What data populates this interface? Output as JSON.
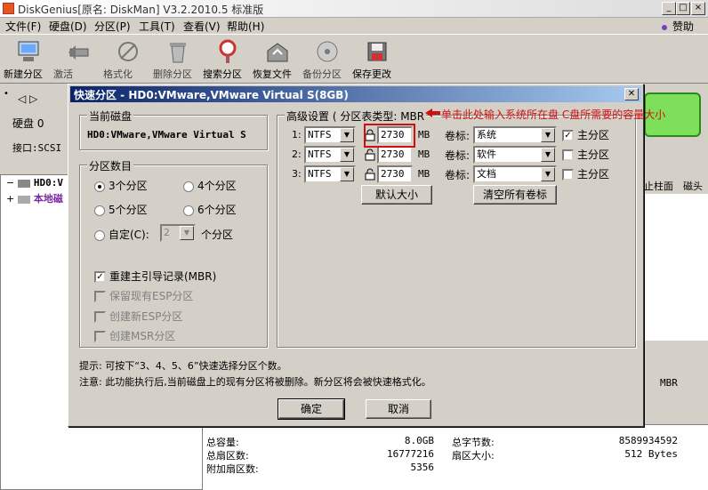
{
  "window": {
    "title": "DiskGenius[原名: DiskMan] V3.2.2010.5 标准版"
  },
  "menu": [
    "文件(F)",
    "硬盘(D)",
    "分区(P)",
    "工具(T)",
    "查看(V)",
    "帮助(H)"
  ],
  "sponsor": "赞助",
  "toolbar": [
    {
      "label": "新建分区",
      "icon": "new-partition-icon"
    },
    {
      "label": "激活",
      "icon": "activate-icon"
    },
    {
      "label": "格式化",
      "icon": "format-icon"
    },
    {
      "label": "删除分区",
      "icon": "delete-partition-icon"
    },
    {
      "label": "搜索分区",
      "icon": "search-partition-icon"
    },
    {
      "label": "恢复文件",
      "icon": "recover-files-icon"
    },
    {
      "label": "备份分区",
      "icon": "backup-partition-icon"
    },
    {
      "label": "保存更改",
      "icon": "save-changes-icon"
    }
  ],
  "left": {
    "disk_label": "硬盘 0",
    "interface_label": "接口:SCSI"
  },
  "tree": {
    "row1": "HD0:V",
    "row2": "本地磁"
  },
  "right": {
    "col1": "止柱面",
    "col2": "磁头",
    "mbr": "MBR"
  },
  "bottom": {
    "total_capacity_label": "总容量:",
    "total_capacity": "8.0GB",
    "total_sectors_label": "总扇区数:",
    "total_sectors": "16777216",
    "extra_sectors_label": "附加扇区数:",
    "extra_sectors": "5356",
    "total_bytes_label": "总字节数:",
    "total_bytes": "8589934592",
    "sector_size_label": "扇区大小:",
    "sector_size": "512 Bytes"
  },
  "dialog": {
    "title": "快速分区 - HD0:VMware,VMware Virtual S(8GB)",
    "current_disk_group": "当前磁盘",
    "current_disk_value": "HD0:VMware,VMware Virtual S",
    "partition_count_group": "分区数目",
    "radio_3": "3个分区",
    "radio_4": "4个分区",
    "radio_5": "5个分区",
    "radio_6": "6个分区",
    "radio_custom": "自定(C):",
    "custom_value": "2",
    "custom_unit": "个分区",
    "rebuild_mbr": "重建主引导记录(MBR)",
    "keep_esp": "保留现有ESP分区",
    "create_esp": "创建新ESP分区",
    "create_msr": "创建MSR分区",
    "advanced_group": "高级设置",
    "table_type_label": "( 分区表类型: MBR",
    "rows": [
      {
        "num": "1:",
        "fs": "NTFS",
        "size": "2730",
        "unit": "MB",
        "vol_label": "卷标:",
        "vol": "系统",
        "primary": "主分区"
      },
      {
        "num": "2:",
        "fs": "NTFS",
        "size": "2730",
        "unit": "MB",
        "vol_label": "卷标:",
        "vol": "软件",
        "primary": "主分区"
      },
      {
        "num": "3:",
        "fs": "NTFS",
        "size": "2730",
        "unit": "MB",
        "vol_label": "卷标:",
        "vol": "文档",
        "primary": "主分区"
      }
    ],
    "default_size_btn": "默认大小",
    "clear_labels_btn": "清空所有卷标",
    "tip1": "提示: 可按下“3、4、5、6”快速选择分区个数。",
    "tip2": "注意: 此功能执行后,当前磁盘上的现有分区将被删除。新分区将会被快速格式化。",
    "ok": "确定",
    "cancel": "取消"
  },
  "annotation": "单击此处输入系统所在盘 C盘所需要的容量大小",
  "colors": {
    "annotation": "#d01010",
    "dialog_title": "#0a246a",
    "disk_bar": "#7ee05a"
  }
}
